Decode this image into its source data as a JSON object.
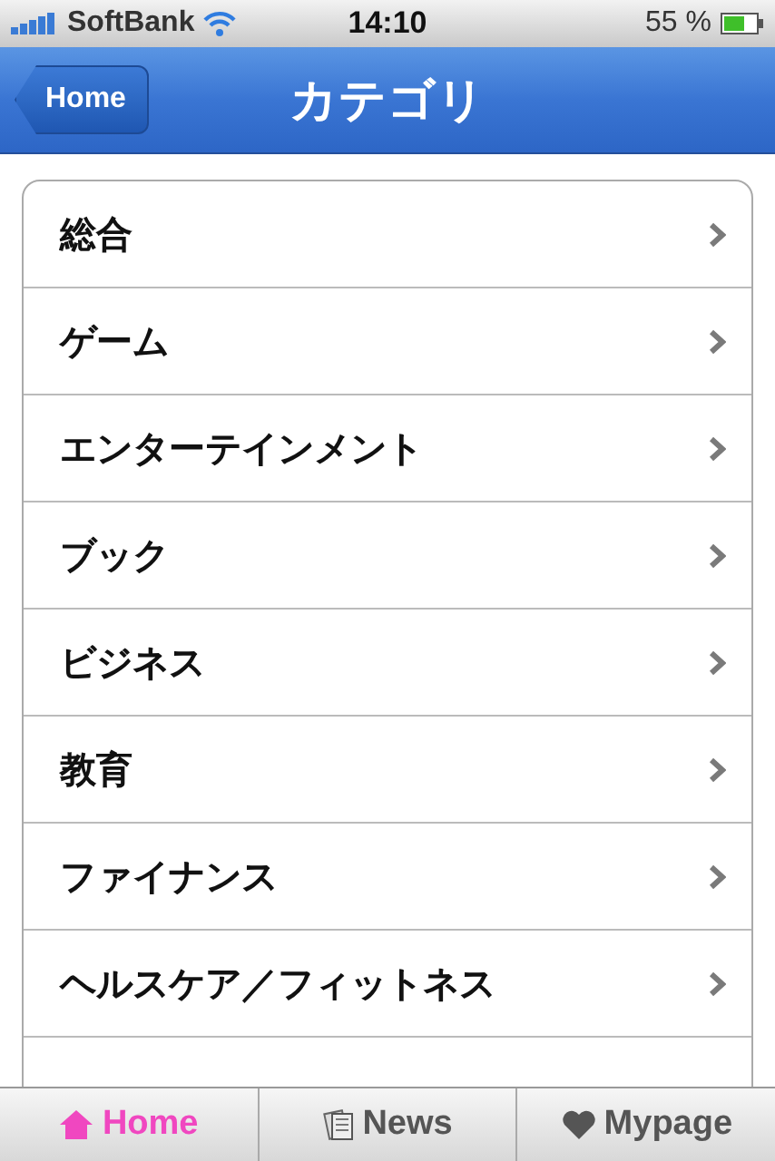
{
  "status_bar": {
    "carrier": "SoftBank",
    "time": "14:10",
    "battery": "55 %"
  },
  "nav_bar": {
    "back": "Home",
    "title": "カテゴリ"
  },
  "categories": [
    {
      "label": "総合"
    },
    {
      "label": "ゲーム"
    },
    {
      "label": "エンターテインメント"
    },
    {
      "label": "ブック"
    },
    {
      "label": "ビジネス"
    },
    {
      "label": "教育"
    },
    {
      "label": "ファイナンス"
    },
    {
      "label": "ヘルスケア／フィットネス"
    }
  ],
  "tabs": [
    {
      "label": "Home",
      "kind": "home",
      "selected": true
    },
    {
      "label": "News",
      "kind": "news",
      "selected": false
    },
    {
      "label": "Mypage",
      "kind": "mypage",
      "selected": false
    }
  ]
}
